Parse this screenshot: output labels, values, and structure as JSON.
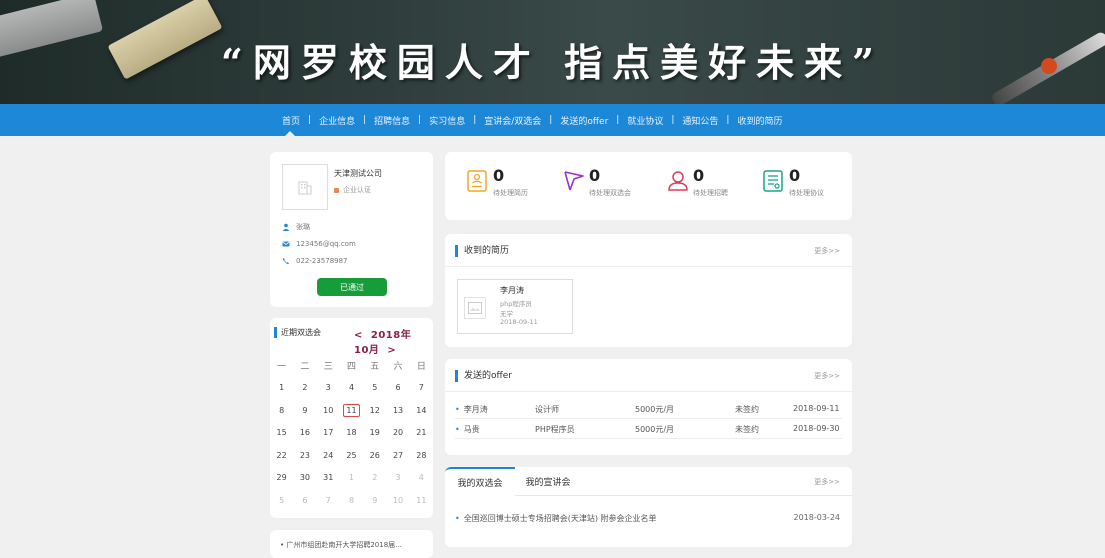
{
  "banner": {
    "slogan": "“网罗校园人才 指点美好未来”"
  },
  "nav": {
    "items": [
      "首页",
      "企业信息",
      "招聘信息",
      "实习信息",
      "宣讲会/双选会",
      "发送的offer",
      "就业协议",
      "通知公告",
      "收到的简历"
    ],
    "separator": "|"
  },
  "profile": {
    "company": "天津测试公司",
    "cert": "企业认证",
    "contact_name": "张璐",
    "email": "123456@qq.com",
    "phone": "022-23578987",
    "status_button": "已通过"
  },
  "calendar": {
    "title": "近期双选会",
    "prev": "<",
    "year": "2018年",
    "month": "10月",
    "next": ">",
    "weekdays": [
      "一",
      "二",
      "三",
      "四",
      "五",
      "六",
      "日"
    ],
    "weeks": [
      [
        "1",
        "2",
        "3",
        "4",
        "5",
        "6",
        "7"
      ],
      [
        "8",
        "9",
        "10",
        "11",
        "12",
        "13",
        "14"
      ],
      [
        "15",
        "16",
        "17",
        "18",
        "19",
        "20",
        "21"
      ],
      [
        "22",
        "23",
        "24",
        "25",
        "26",
        "27",
        "28"
      ],
      [
        "29",
        "30",
        "31",
        "1",
        "2",
        "3",
        "4"
      ],
      [
        "5",
        "6",
        "7",
        "8",
        "9",
        "10",
        "11"
      ]
    ],
    "highlighted_day": "11",
    "news_item": "• 广州市组团赴南开大学招聘2018届..."
  },
  "stats": [
    {
      "value": "0",
      "label": "待处理简历",
      "icon": "resume-icon",
      "color": "#f5a623"
    },
    {
      "value": "0",
      "label": "待处理双选会",
      "icon": "flag-icon",
      "color": "#9b2fc9"
    },
    {
      "value": "0",
      "label": "待处理招聘",
      "icon": "people-icon",
      "color": "#e23b5b"
    },
    {
      "value": "0",
      "label": "待处理协议",
      "icon": "agreement-icon",
      "color": "#1aa784"
    }
  ],
  "resumes": {
    "title": "收到的简历",
    "more": "更多>>",
    "card": {
      "name": "李月涛",
      "position": "php程序员",
      "degree": "无学",
      "date": "2018-09-11"
    }
  },
  "offers": {
    "title": "发送的offer",
    "more": "更多>>",
    "rows": [
      {
        "name": "李月涛",
        "job": "设计师",
        "salary": "5000元/月",
        "status": "未签约",
        "date": "2018-09-11"
      },
      {
        "name": "马贵",
        "job": "PHP程序员",
        "salary": "5000元/月",
        "status": "未签约",
        "date": "2018-09-30"
      }
    ]
  },
  "fairs": {
    "tab_active": "我的双选会",
    "tab_other": "我的宣讲会",
    "more": "更多>>",
    "item": "全国巡回博士硕士专场招聘会(天津站) 附参会企业名单",
    "date": "2018-03-24"
  }
}
